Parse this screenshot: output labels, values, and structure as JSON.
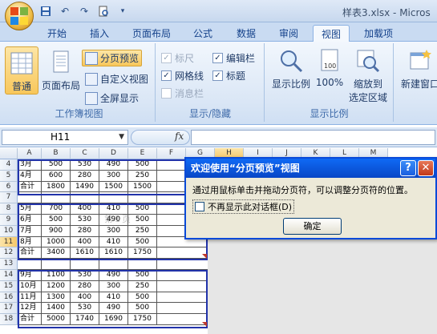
{
  "app": {
    "window_title": "样表3.xlsx - Micros"
  },
  "tabs": [
    {
      "label": "开始"
    },
    {
      "label": "插入"
    },
    {
      "label": "页面布局"
    },
    {
      "label": "公式"
    },
    {
      "label": "数据"
    },
    {
      "label": "审阅"
    },
    {
      "label": "视图"
    },
    {
      "label": "加载项"
    }
  ],
  "active_tab": "视图",
  "ribbon": {
    "workbook_views": {
      "label": "工作簿视图",
      "normal": "普通",
      "page_layout": "页面布局",
      "page_break_preview": "分页预览",
      "custom_views": "自定义视图",
      "full_screen": "全屏显示"
    },
    "show_hide": {
      "label": "显示/隐藏",
      "ruler": "标尺",
      "formula_bar": "编辑栏",
      "gridlines": "网格线",
      "headings": "标题",
      "message_bar": "消息栏"
    },
    "zoom": {
      "label": "显示比例",
      "zoom": "显示比例",
      "hundred": "100%",
      "zoom_selection_line1": "缩放到",
      "zoom_selection_line2": "选定区域"
    },
    "window": {
      "new_window": "新建窗口"
    }
  },
  "formula_bar": {
    "name_box": "H11",
    "fx": "fx",
    "formula": ""
  },
  "sheet": {
    "columns": [
      "A",
      "B",
      "C",
      "D",
      "E",
      "F",
      "G",
      "H",
      "I",
      "J",
      "K",
      "L",
      "M"
    ],
    "selected_column": "H",
    "selected_row": "11",
    "rows": [
      {
        "num": "4",
        "cells": [
          "3月",
          "500",
          "530",
          "490",
          "500"
        ]
      },
      {
        "num": "5",
        "cells": [
          "4月",
          "600",
          "280",
          "300",
          "250"
        ]
      },
      {
        "num": "6",
        "cells": [
          "合计",
          "1800",
          "1490",
          "1500",
          "1500"
        ]
      },
      {
        "num": "7",
        "cells": [
          "",
          "",
          "",
          "",
          ""
        ]
      },
      {
        "num": "8",
        "cells": [
          "5月",
          "700",
          "400",
          "410",
          "500"
        ]
      },
      {
        "num": "9",
        "cells": [
          "6月",
          "500",
          "530",
          "490",
          "500"
        ]
      },
      {
        "num": "10",
        "cells": [
          "7月",
          "900",
          "280",
          "300",
          "250"
        ]
      },
      {
        "num": "11",
        "cells": [
          "8月",
          "1000",
          "400",
          "410",
          "500"
        ]
      },
      {
        "num": "12",
        "cells": [
          "合计",
          "3400",
          "1610",
          "1610",
          "1750"
        ]
      },
      {
        "num": "13",
        "cells": [
          "",
          "",
          "",
          "",
          ""
        ]
      },
      {
        "num": "14",
        "cells": [
          "9月",
          "1100",
          "530",
          "490",
          "500"
        ]
      },
      {
        "num": "15",
        "cells": [
          "10月",
          "1200",
          "280",
          "300",
          "250"
        ]
      },
      {
        "num": "16",
        "cells": [
          "11月",
          "1300",
          "400",
          "410",
          "500"
        ]
      },
      {
        "num": "17",
        "cells": [
          "12月",
          "1400",
          "530",
          "490",
          "500"
        ]
      },
      {
        "num": "18",
        "cells": [
          "合计",
          "5000",
          "1740",
          "1690",
          "1750"
        ]
      }
    ],
    "page_watermark": "第1页"
  },
  "dialog": {
    "title": "欢迎使用“分页预览”视图",
    "message": "通过用鼠标单击并拖动分页符，可以调整分页符的位置。",
    "checkbox_label": "不再显示此对话框(D)",
    "ok_label": "确定",
    "help_label": "?",
    "close_label": "✕"
  }
}
